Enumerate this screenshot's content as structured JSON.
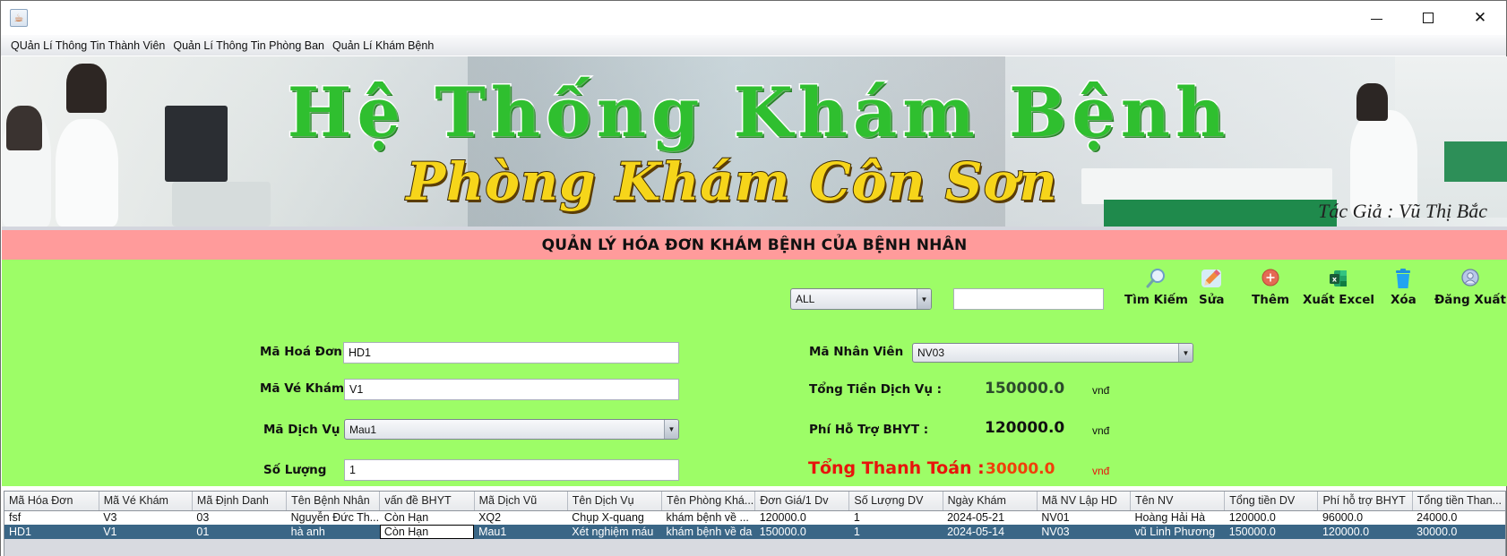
{
  "window": {
    "title": "",
    "controls": {
      "minimize": "–",
      "maximize": "☐",
      "close": "✕"
    }
  },
  "menu": {
    "items": [
      {
        "label": "QUản Lí Thông Tin Thành Viên"
      },
      {
        "label": "Quản Lí Thông Tin Phòng Ban"
      },
      {
        "label": "Quản Lí Khám Bệnh"
      }
    ]
  },
  "banner": {
    "title": "Hệ Thống Khám Bệnh",
    "subtitle": "Phòng Khám Côn Sơn",
    "author": "Tác Giả : Vũ Thị Bắc"
  },
  "section": {
    "title": "QUẢN LÝ HÓA ĐƠN KHÁM BỆNH CỦA BỆNH NHÂN"
  },
  "search": {
    "filter_selected": "ALL",
    "query_value": ""
  },
  "toolbar": {
    "buttons": [
      {
        "label": "Tìm Kiếm",
        "icon": "search-icon"
      },
      {
        "label": "Sửa",
        "icon": "pencil-icon"
      },
      {
        "label": "Thêm",
        "icon": "add-icon"
      },
      {
        "label": "Xuất Excel",
        "icon": "excel-icon"
      },
      {
        "label": "Xóa",
        "icon": "trash-icon"
      },
      {
        "label": "Đăng Xuất",
        "icon": "user-icon"
      }
    ]
  },
  "form": {
    "ma_hoa_don": {
      "label": "Mã Hoá Đơn",
      "value": "HD1"
    },
    "ma_ve_kham": {
      "label": "Mã Vé Khám",
      "value": "V1"
    },
    "ma_dich_vu": {
      "label": "Mã Dịch Vụ",
      "value": "Mau1"
    },
    "so_luong": {
      "label": "Số Lượng",
      "value": "1"
    },
    "ma_nhan_vien": {
      "label": "Mã Nhân Viên",
      "value": "NV03"
    },
    "tong_tien_dich_vu": {
      "label": "Tổng Tiền Dịch Vụ :",
      "value": "150000.0",
      "unit": "vnđ"
    },
    "phi_ho_tro_bhyt": {
      "label": "Phí Hỗ Trợ BHYT :",
      "value": "120000.0",
      "unit": "vnđ"
    },
    "tong_thanh_toan": {
      "label": "Tổng Thanh Toán :",
      "value": "30000.0",
      "unit": "vnđ"
    }
  },
  "colors": {
    "form_background": "#9dfd67",
    "section_bar": "#ff9b9b",
    "total_label": "#e8140c",
    "total_value": "#f0400a",
    "service_total_value": "#2c4a2c",
    "selected_row": "#3a6686"
  },
  "table": {
    "columns": [
      "Mã Hóa Đơn",
      "Mã Vé Khám",
      "Mã Định Danh",
      "Tên Bệnh Nhân",
      "vấn đề BHYT",
      "Mã Dịch Vũ",
      "Tên Dịch Vụ",
      "Tên Phòng Khá...",
      "Đơn Giá/1 Dv",
      "Số Lượng DV",
      "Ngày Khám",
      "Mã NV Lập HD",
      "Tên NV",
      "Tổng tiền DV",
      "Phí hỗ trợ BHYT",
      "Tổng tiền Than..."
    ],
    "rows": [
      {
        "selected": false,
        "cells": [
          "fsf",
          "V3",
          "03",
          "Nguyễn Đức Th...",
          "Còn Hạn",
          "XQ2",
          "Chụp X-quang",
          "khám bệnh về ...",
          "120000.0",
          "1",
          "2024-05-21",
          "NV01",
          "Hoàng Hải Hà",
          "120000.0",
          "96000.0",
          "24000.0"
        ]
      },
      {
        "selected": true,
        "cells": [
          "HD1",
          "V1",
          "01",
          "hà anh",
          "Còn Hạn",
          "Mau1",
          "Xét nghiệm máu",
          "khám bệnh về da",
          "150000.0",
          "1",
          "2024-05-14",
          "NV03",
          "vũ Linh Phương",
          "150000.0",
          "120000.0",
          "30000.0"
        ]
      }
    ]
  }
}
